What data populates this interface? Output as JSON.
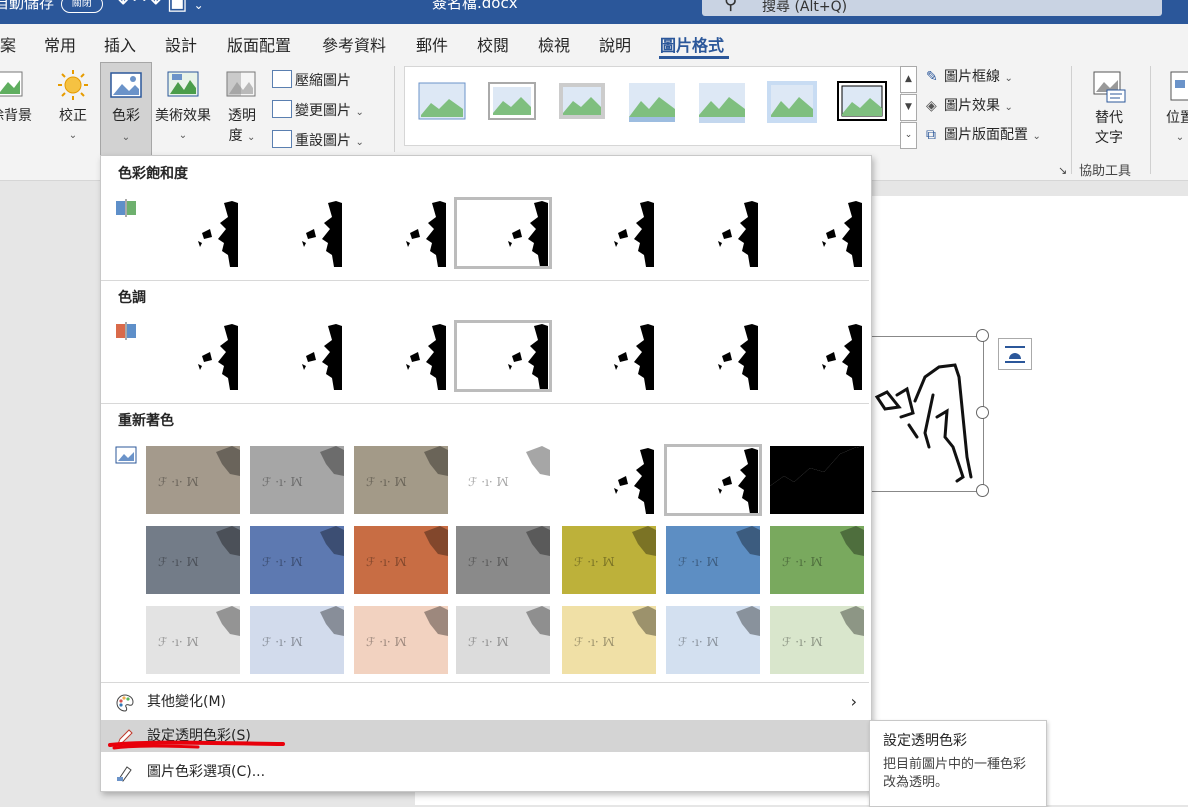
{
  "titlebar": {
    "autosave_label": "自動儲存",
    "autosave_state": "關閉",
    "qat_icons": [
      "undo-icon",
      "redo-icon",
      "save-icon",
      "customize-icon"
    ],
    "doc_name": "簽名檔.docx",
    "search_placeholder": "搜尋 (Alt+Q)"
  },
  "tabs": [
    {
      "label": "案"
    },
    {
      "label": "常用"
    },
    {
      "label": "插入"
    },
    {
      "label": "設計"
    },
    {
      "label": "版面配置"
    },
    {
      "label": "參考資料"
    },
    {
      "label": "郵件"
    },
    {
      "label": "校閱"
    },
    {
      "label": "檢視"
    },
    {
      "label": "說明"
    },
    {
      "label": "圖片格式",
      "active": true
    }
  ],
  "ribbon": {
    "remove_bg": "除背景",
    "corrections": "校正",
    "color": "色彩",
    "artistic": "美術效果",
    "transparency_1": "透明",
    "transparency_2": "度",
    "compress": "壓縮圖片",
    "change": "變更圖片",
    "reset": "重設圖片",
    "border": "圖片框線",
    "effects": "圖片效果",
    "layout": "圖片版面配置",
    "alt_text_1": "替代",
    "alt_text_2": "文字",
    "position": "位置",
    "accessibility_group": "協助工具"
  },
  "color_menu": {
    "saturation_header": "色彩飽和度",
    "tone_header": "色調",
    "recolor_header": "重新著色",
    "more_variations": "其他變化(M)",
    "set_transparent": "設定透明色彩(S)",
    "color_options": "圖片色彩選項(C)...",
    "recolor_rows": [
      [
        "#a49a8c",
        "#a6a6a6",
        "#a39a88",
        "#ffffff",
        "#ffffff",
        "#ffffff",
        "#000000"
      ],
      [
        "#737c88",
        "#5d79b1",
        "#c86d44",
        "#8a8a8a",
        "#bdb13a",
        "#5d8ec3",
        "#79a95e"
      ],
      [
        "#e3e3e3",
        "#d2dbec",
        "#f2d2c0",
        "#dcdcdc",
        "#f0e0a6",
        "#d3e0f0",
        "#d9e6cc"
      ]
    ]
  },
  "tooltip": {
    "title": "設定透明色彩",
    "desc": "把目前圖片中的一種色彩改為透明。"
  },
  "colors": {
    "accent": "#2b579a",
    "annotation": "#e8000b"
  }
}
